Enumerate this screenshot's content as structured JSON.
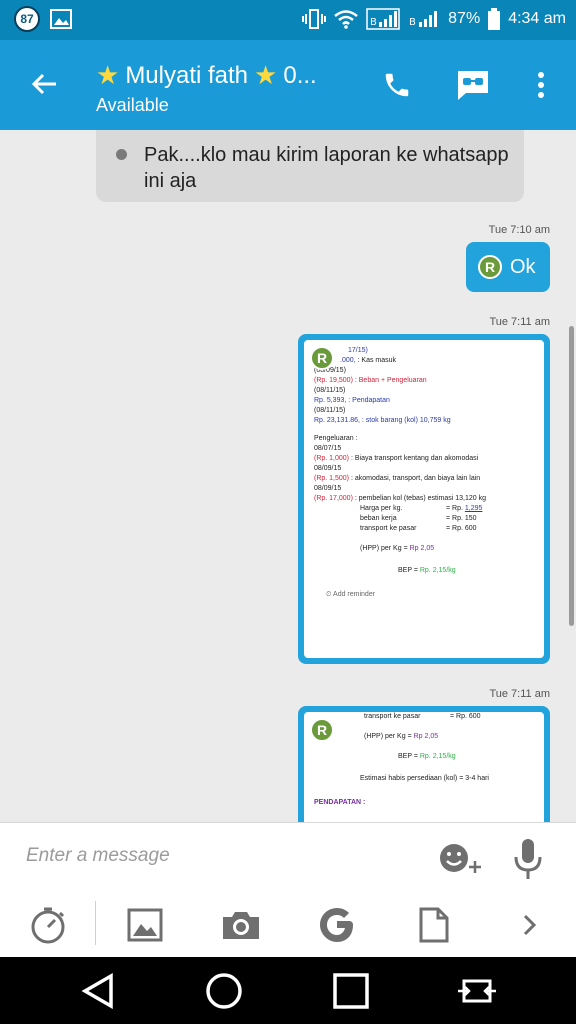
{
  "status_bar": {
    "notification_count": "87",
    "battery_percent": "87%",
    "time": "4:34 am"
  },
  "header": {
    "contact_name": "Mulyati fath",
    "name_suffix": "0...",
    "status": "Available",
    "icons": [
      "back-arrow-icon",
      "phone-icon",
      "sms-mode-icon",
      "more-vert-icon"
    ]
  },
  "messages": {
    "incoming_text": "Pak....klo mau kirim laporan ke whatsapp ini aja",
    "msg1_time": "Tue 7:10 am",
    "msg1_text": "Ok",
    "msg2_time": "Tue 7:11 am",
    "msg3_time": "Tue 7:11 am",
    "avatar_letter": "R"
  },
  "image1_doc": {
    "line1a": "17/15)",
    "line2a": ".000,",
    "line2b": " : Kas masuk",
    "line3": "(08/09/15)",
    "line4a": "(Rp. 19,500)",
    "line4b": " : Beban + Pengeluaran",
    "line5": "(08/11/15)",
    "line6a": "Rp. 5,393,",
    "line6b": " : Pendapatan",
    "line7": "(08/11/15)",
    "line8a": "Rp. 23,131.86,",
    "line8b": " : stok barang (kol) 10,759 kg",
    "line9": "Pengeluaran :",
    "line10": "08/07/15",
    "line11a": "(Rp. 1,000)",
    "line11b": " : Biaya transport kentang dan akomodasi",
    "line12": "08/09/15",
    "line13a": "(Rp. 1,500)",
    "line13b": " : akomodasi, transport, dan biaya lain lain",
    "line14": "08/09/15",
    "line15a": "(Rp. 17,000)",
    "line15b": " : pembelian kol (tebas) estimasi 13,120 kg",
    "line16a": "Harga per kg.",
    "line16b": "= Rp. ",
    "line16c": "1,295",
    "line17a": "beban kerja",
    "line17b": "= Rp. 150",
    "line18a": "transport ke pasar",
    "line18b": "= Rp. 600",
    "line19a": "(HPP) per Kg = ",
    "line19b": "Rp 2,05",
    "line20a": "BEP = ",
    "line20b": "Rp. 2,15/kg",
    "reminder": "Add reminder"
  },
  "image2_doc": {
    "line1a": "transport ke pasar",
    "line1b": "= Rp. 600",
    "line2a": "(HPP) per Kg = ",
    "line2b": "Rp 2,05",
    "line3a": "BEP = ",
    "line3b": "Rp. 2,15/kg",
    "line4": "Estimasi habis persediaan (kol) = 3-4 hari",
    "line5": "PENDAPATAN :"
  },
  "composer": {
    "placeholder": "Enter a message",
    "tools": [
      "timer-icon",
      "gallery-icon",
      "camera-icon",
      "google-icon",
      "document-icon",
      "chevron-right-icon"
    ]
  },
  "colors": {
    "status_bar": "#0a85b8",
    "app_bar": "#1a9bd7",
    "outgoing_bubble": "#23a3db",
    "incoming_bubble": "#d9d9d9",
    "chat_background": "#ebebeb",
    "star": "#ffd83b"
  }
}
